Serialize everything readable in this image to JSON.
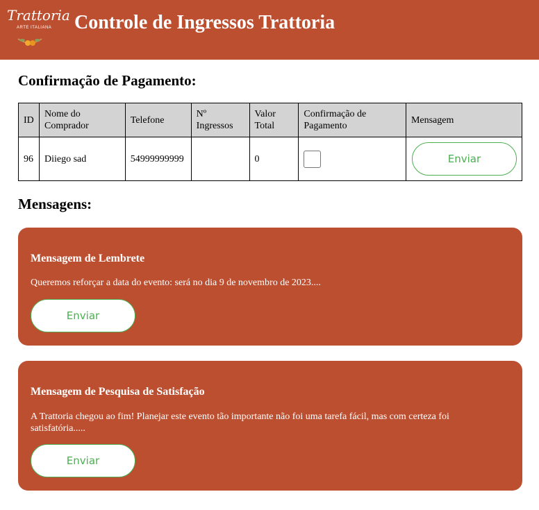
{
  "header": {
    "logo_text": "Trattoria",
    "logo_subtext": "ARTE ITALIANA",
    "title": "Controle de Ingressos Trattoria",
    "brand_color": "#bd4f31"
  },
  "payment_section": {
    "title": "Confirmação de Pagamento:",
    "columns": [
      "ID",
      "Nome do Comprador",
      "Telefone",
      "Nº Ingressos",
      "Valor Total",
      "Confirmação de Pagamento",
      "Mensagem"
    ],
    "rows": [
      {
        "id": "96",
        "name": "Diiego sad",
        "phone": "54999999999",
        "tickets": "",
        "total": "0",
        "confirmed": false,
        "button_label": "Enviar"
      }
    ]
  },
  "messages_section": {
    "title": "Mensagens:",
    "cards": [
      {
        "title": "Mensagem de Lembrete",
        "text": "Queremos reforçar a data do evento: será no dia 9 de novembro de 2023....",
        "button_label": "Enviar"
      },
      {
        "title": "Mensagem de Pesquisa de Satisfação",
        "text": "A Trattoria chegou ao fim! Planejar este evento tão importante não foi uma tarefa fácil, mas com certeza foi satisfatória.....",
        "button_label": "Enviar"
      }
    ]
  },
  "colors": {
    "accent": "#bd4f31",
    "button_text": "#4caf50",
    "table_header_bg": "#d3d3d3"
  },
  "icons": [
    "trattoria-logo-icon",
    "checkbox-icon"
  ]
}
